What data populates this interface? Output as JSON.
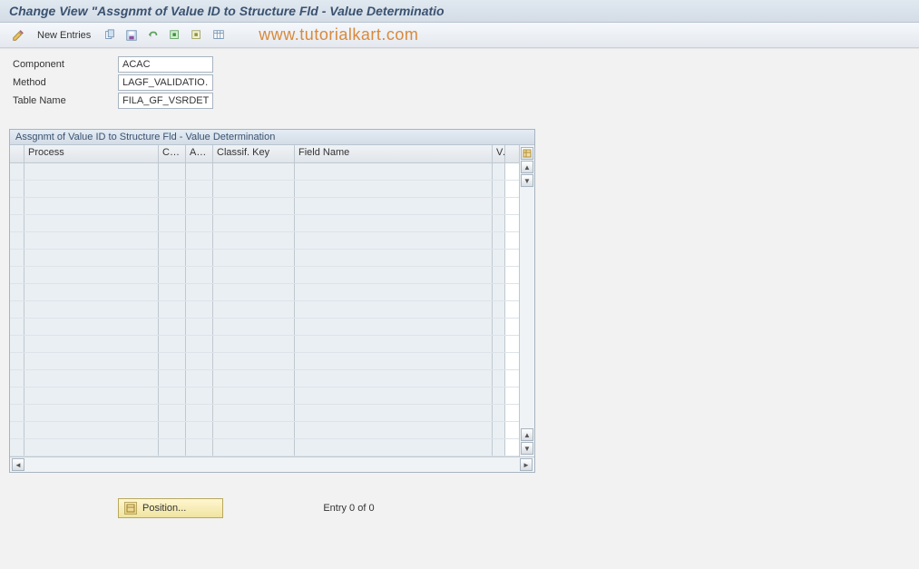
{
  "title": "Change View \"Assgnmt of Value ID to Structure Fld - Value Determinatio",
  "toolbar": {
    "new_entries": "New Entries"
  },
  "watermark": "www.tutorialkart.com",
  "form": {
    "component_label": "Component",
    "component_value": "ACAC",
    "method_label": "Method",
    "method_value": "LAGF_VALIDATIO…",
    "table_label": "Table Name",
    "table_value": "FILA_GF_VSRDET"
  },
  "table": {
    "title": "Assgnmt of Value ID to Structure Fld - Value Determination",
    "columns": {
      "process": "Process",
      "co": "Co...",
      "ac": "Ac...",
      "classif": "Classif. Key",
      "field": "Field Name",
      "va": "Va"
    },
    "row_count": 17
  },
  "footer": {
    "position_label": "Position...",
    "entry_text": "Entry 0 of 0"
  },
  "icons": {
    "pencil": "pencil-icon",
    "copy": "copy-icon",
    "save": "save-icon",
    "undo": "undo-icon",
    "select_all": "select-all-icon",
    "deselect": "deselect-icon",
    "table_settings": "table-settings-icon"
  }
}
